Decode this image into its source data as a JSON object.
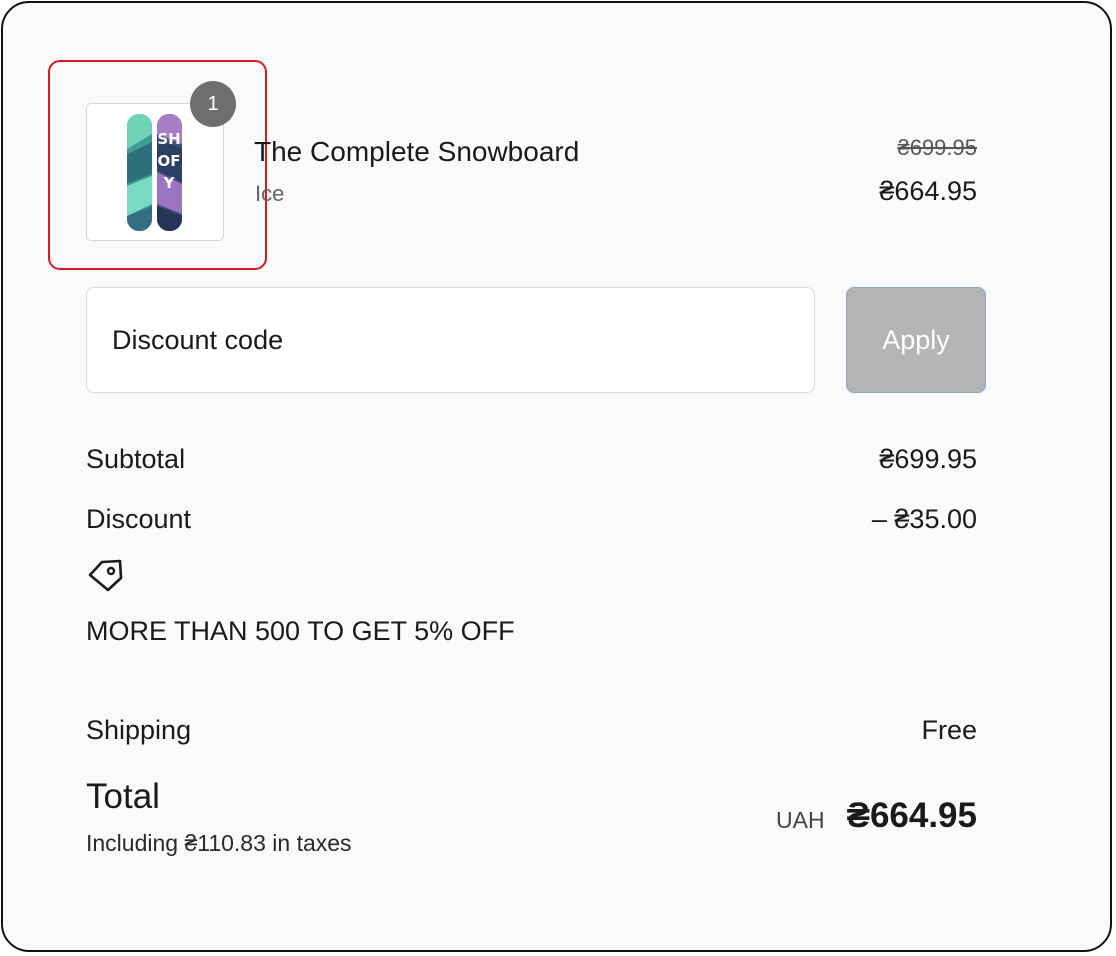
{
  "product": {
    "quantity": "1",
    "name": "The Complete Snowboard",
    "variant": "Ice",
    "compare_at_price": "₴699.95",
    "price": "₴664.95",
    "image_icon": "snowboard-image"
  },
  "discount": {
    "placeholder": "Discount code",
    "apply_label": "Apply"
  },
  "summary": {
    "subtotal_label": "Subtotal",
    "subtotal_value": "₴699.95",
    "discount_label": "Discount",
    "discount_value": "– ₴35.00",
    "discount_icon": "tag-icon",
    "promo_name": "MORE THAN 500 TO GET 5% OFF",
    "shipping_label": "Shipping",
    "shipping_value": "Free",
    "total_label": "Total",
    "tax_note": "Including ₴110.83 in taxes",
    "currency": "UAH",
    "total_value": "₴664.95"
  },
  "colors": {
    "card_background": "#fafafa",
    "highlight_border": "#d81b22",
    "badge": "#6f6f6f",
    "apply_button": "#b5b5b5"
  }
}
